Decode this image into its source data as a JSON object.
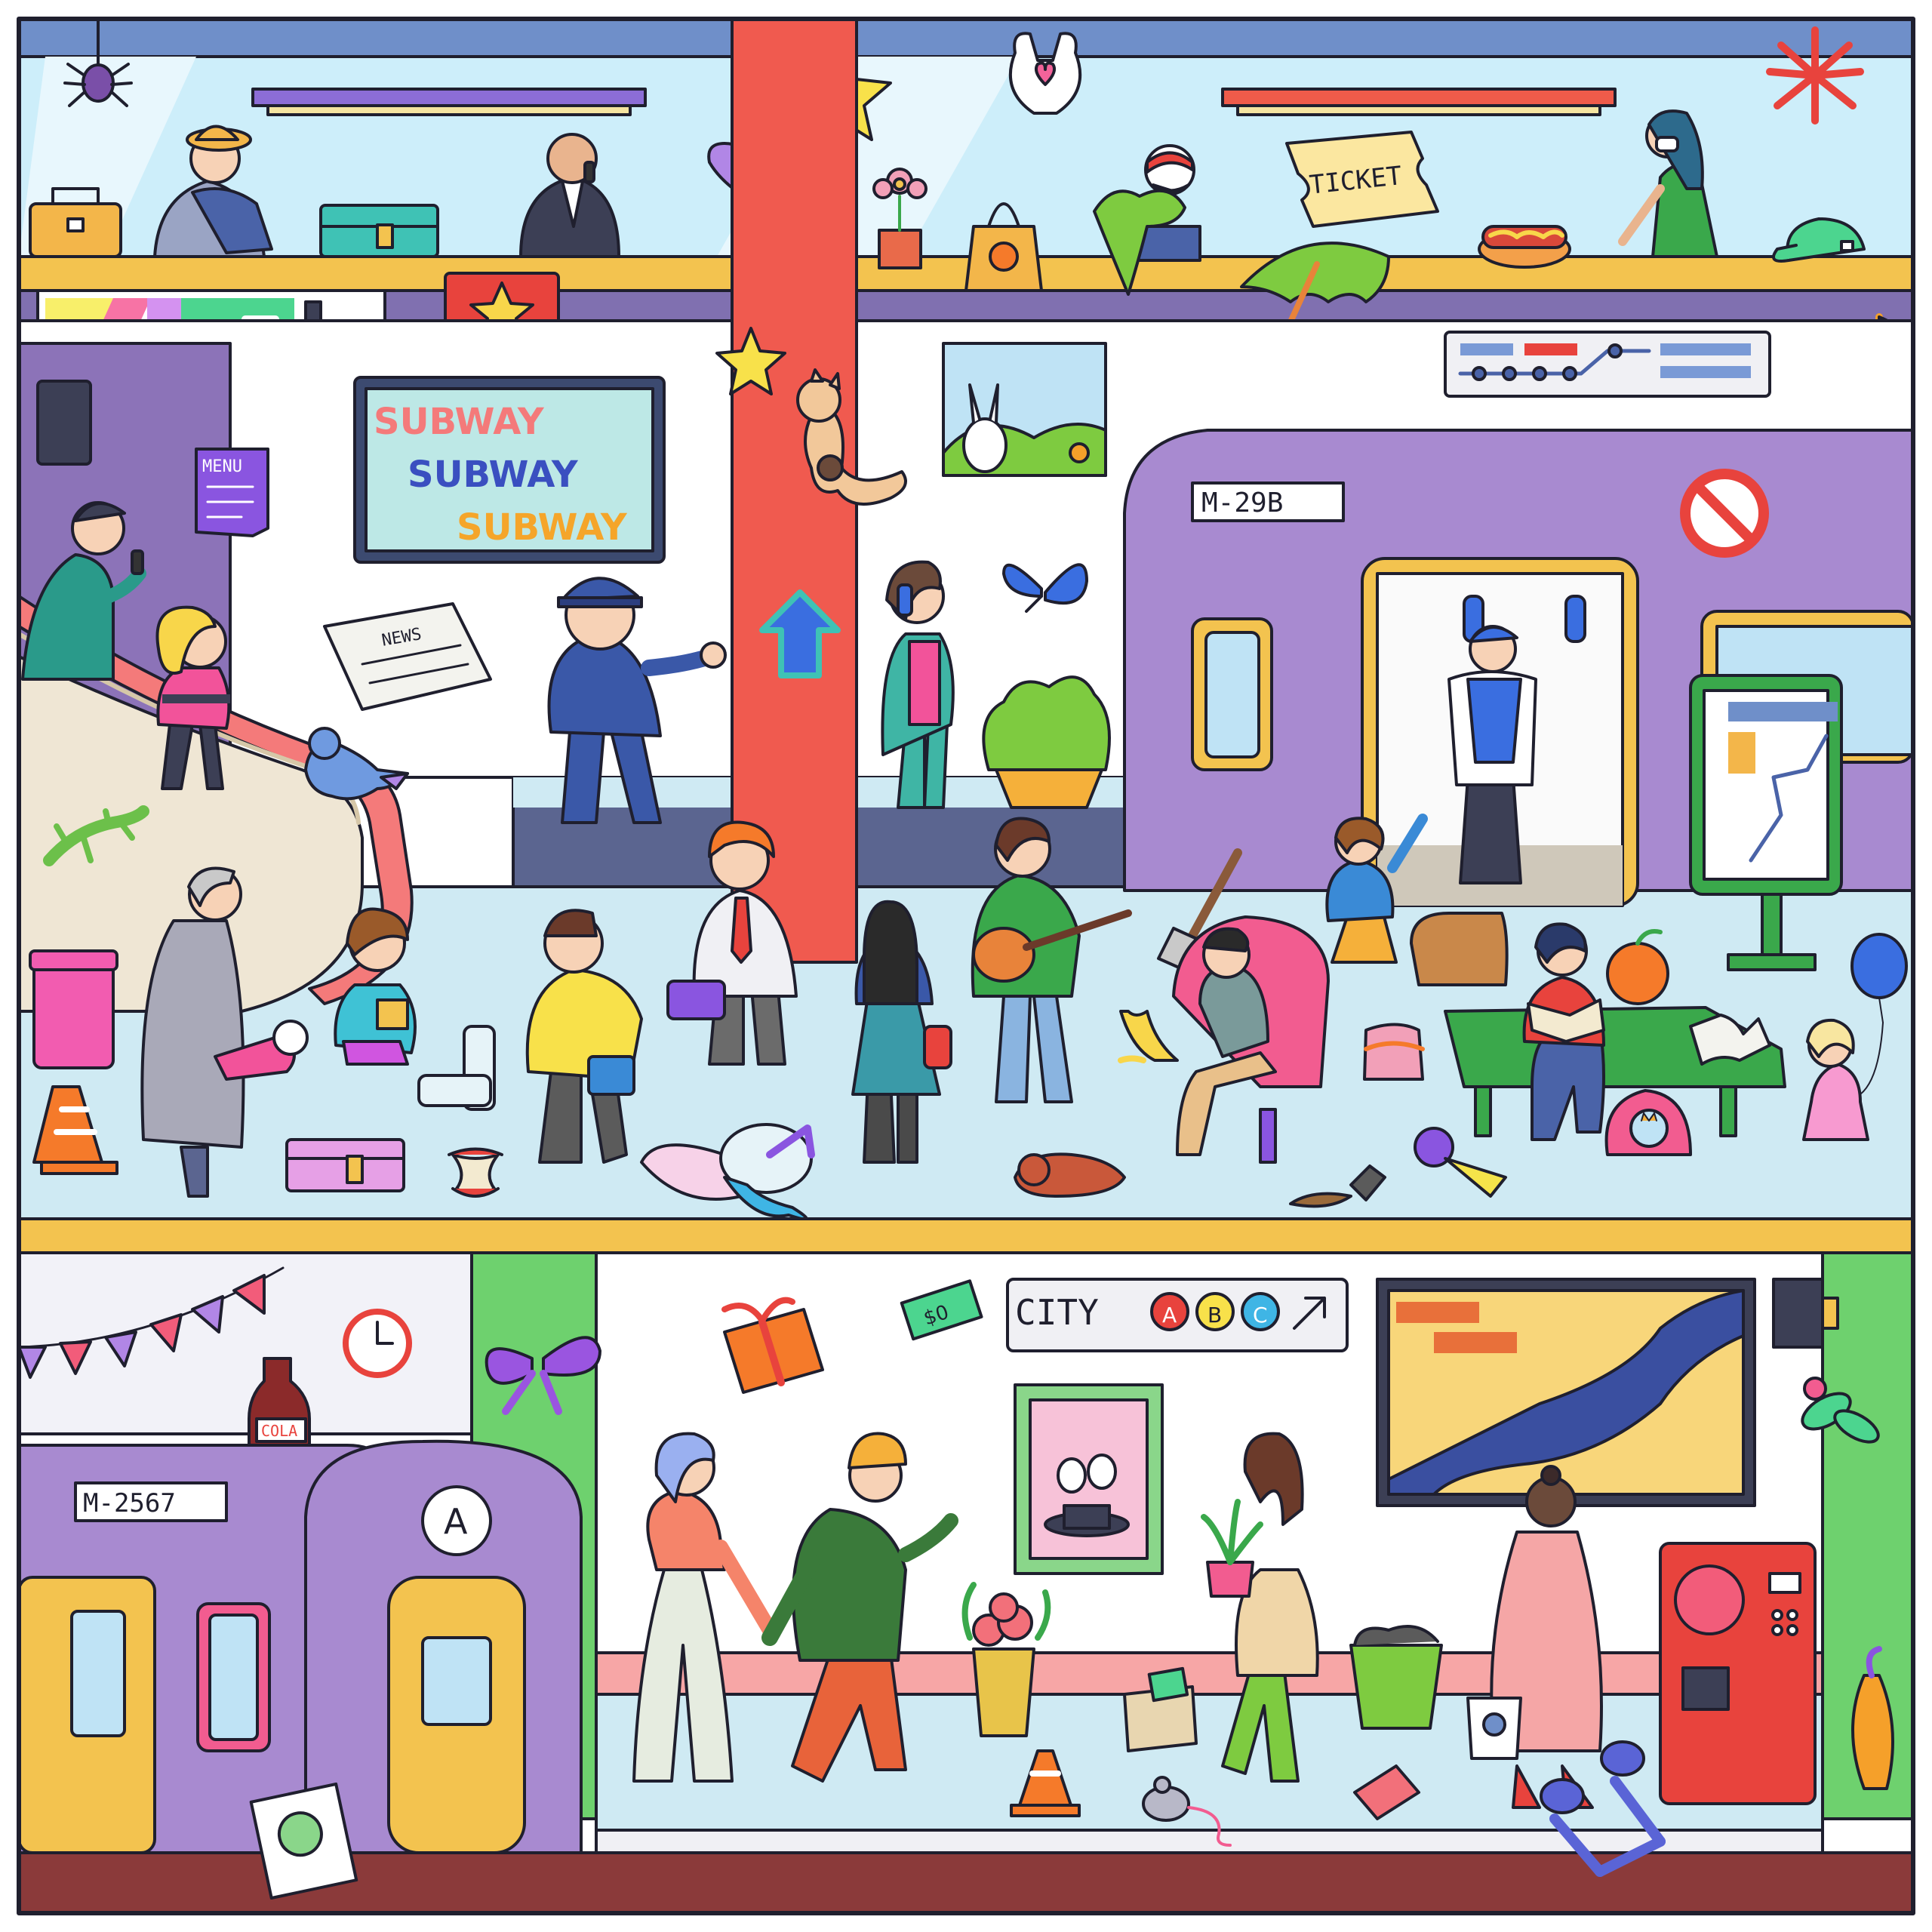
{
  "signs": {
    "subway_line1": "SUBWAY",
    "subway_line2": "SUBWAY",
    "subway_line3": "SUBWAY",
    "menu": "MENU",
    "ticket": "TICKET",
    "news": "NEWS",
    "train_upper": "M-29B",
    "train_lower": "M-2567",
    "station_city": "CITY",
    "line_a": "A",
    "line_b": "B",
    "line_c": "C",
    "cola": "COLA",
    "money": "$0",
    "door_letter": "A"
  },
  "colors": {
    "frame": "#1f1f2e",
    "ceiling": "#6f8fc9",
    "sky": "#cdeefa",
    "ledge": "#f3c34f",
    "train_purple": "#a88ad0",
    "pillar_red": "#f05a4f",
    "floor": "#cfeaf3",
    "platform_dark": "#5b6590",
    "track": "#8b3a3a",
    "green_pillar": "#6ed16e"
  },
  "icons": [
    "spider-icon",
    "star-icon",
    "heart-bag-icon",
    "fireworks-icon",
    "toolbox-icon",
    "suitcase-icon",
    "balloon-icon",
    "flower-pot-icon",
    "orange-bag-icon",
    "beach-ball-icon",
    "cap-icon",
    "hotdog-icon",
    "umbrella-icon",
    "music-note-icon",
    "cat-icon",
    "bunny-poster-icon",
    "butterfly-icon",
    "arrow-up-icon",
    "no-entry-icon",
    "lizard-icon",
    "bird-icon",
    "banana-icon",
    "orange-icon",
    "blue-balloon-icon",
    "clock-icon",
    "bow-icon",
    "gift-icon",
    "cola-bottle-icon",
    "magic-hat-poster-icon",
    "mouse-icon",
    "plant-icon",
    "vending-machine-icon",
    "traffic-cone-icon",
    "photo-icon",
    "double-note-icon"
  ]
}
